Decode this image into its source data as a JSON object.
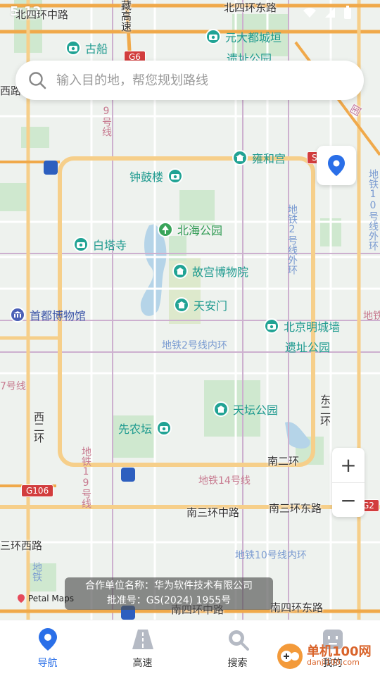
{
  "status": {
    "time": "5:12"
  },
  "search": {
    "placeholder": "输入目的地，帮您规划路线"
  },
  "map": {
    "pois": [
      {
        "name": "古船",
        "kind": "camera",
        "color": "teal"
      },
      {
        "name": "元大都城垣",
        "kind": "camera",
        "color": "teal"
      },
      {
        "name": "遗址公园",
        "kind": "text",
        "color": "teal"
      },
      {
        "name": "雍和宫",
        "kind": "temple",
        "color": "teal"
      },
      {
        "name": "钟鼓楼",
        "kind": "camera",
        "color": "teal"
      },
      {
        "name": "北海公园",
        "kind": "tree",
        "color": "green"
      },
      {
        "name": "白塔寺",
        "kind": "camera",
        "color": "teal"
      },
      {
        "name": "故宫博物院",
        "kind": "palace",
        "color": "teal"
      },
      {
        "name": "天安门",
        "kind": "palace",
        "color": "teal"
      },
      {
        "name": "首都博物馆",
        "kind": "museum",
        "color": "blue"
      },
      {
        "name": "北京明城墙",
        "kind": "camera",
        "color": "teal"
      },
      {
        "name": "遗址公园",
        "kind": "text",
        "color": "teal"
      },
      {
        "name": "天坛公园",
        "kind": "palace",
        "color": "teal"
      },
      {
        "name": "先农坛",
        "kind": "camera",
        "color": "teal"
      }
    ],
    "roads": {
      "top_left": "北四环中路",
      "top_right": "北四环东路",
      "west_road": "西路",
      "west_2nd": "西二环",
      "east_2nd": "东二环",
      "south_2nd": "南二环",
      "south_3rd_mid": "南三环中路",
      "south_3rd_east": "南三环东路",
      "south_3rd_west": "三环西路",
      "south_4th_mid": "南四环中路",
      "south_4th_east": "南四环东路",
      "zang_expressway": "藏高速",
      "guozhan": "国"
    },
    "metro": {
      "line9_top": "9号线",
      "line2_outer": "地铁2号线外环",
      "line2_inner": "地铁2号线内环",
      "line10_east": "地铁10号线外环",
      "line7": "7号线",
      "line9_south": "地铁19号线",
      "line14": "地铁14号线",
      "line10_inner": "地铁10号线内环",
      "line_east_edge": "地铁",
      "line_south_left": "地铁"
    },
    "shields": {
      "g6": "G6",
      "s": "S",
      "g106": "G106",
      "g2": "G2"
    },
    "copyright_line1": "合作单位名称：华为软件技术有限公司",
    "copyright_line2": "批准号：GS(2024) 1955号",
    "brand": "Petal Maps"
  },
  "controls": {
    "zoom_in": "+",
    "zoom_out": "−"
  },
  "tabs": [
    {
      "label": "导航",
      "icon": "location-pin-icon",
      "active": true
    },
    {
      "label": "高速",
      "icon": "highway-icon",
      "active": false
    },
    {
      "label": "搜索",
      "icon": "search-icon",
      "active": false
    },
    {
      "label": "我的",
      "icon": "profile-icon",
      "active": false
    }
  ],
  "watermark": {
    "main": "单机100网",
    "sub": "danji100.com"
  },
  "colors": {
    "accent": "#2a6fe8",
    "teal": "#21a394",
    "ring": "#f0a94a"
  }
}
